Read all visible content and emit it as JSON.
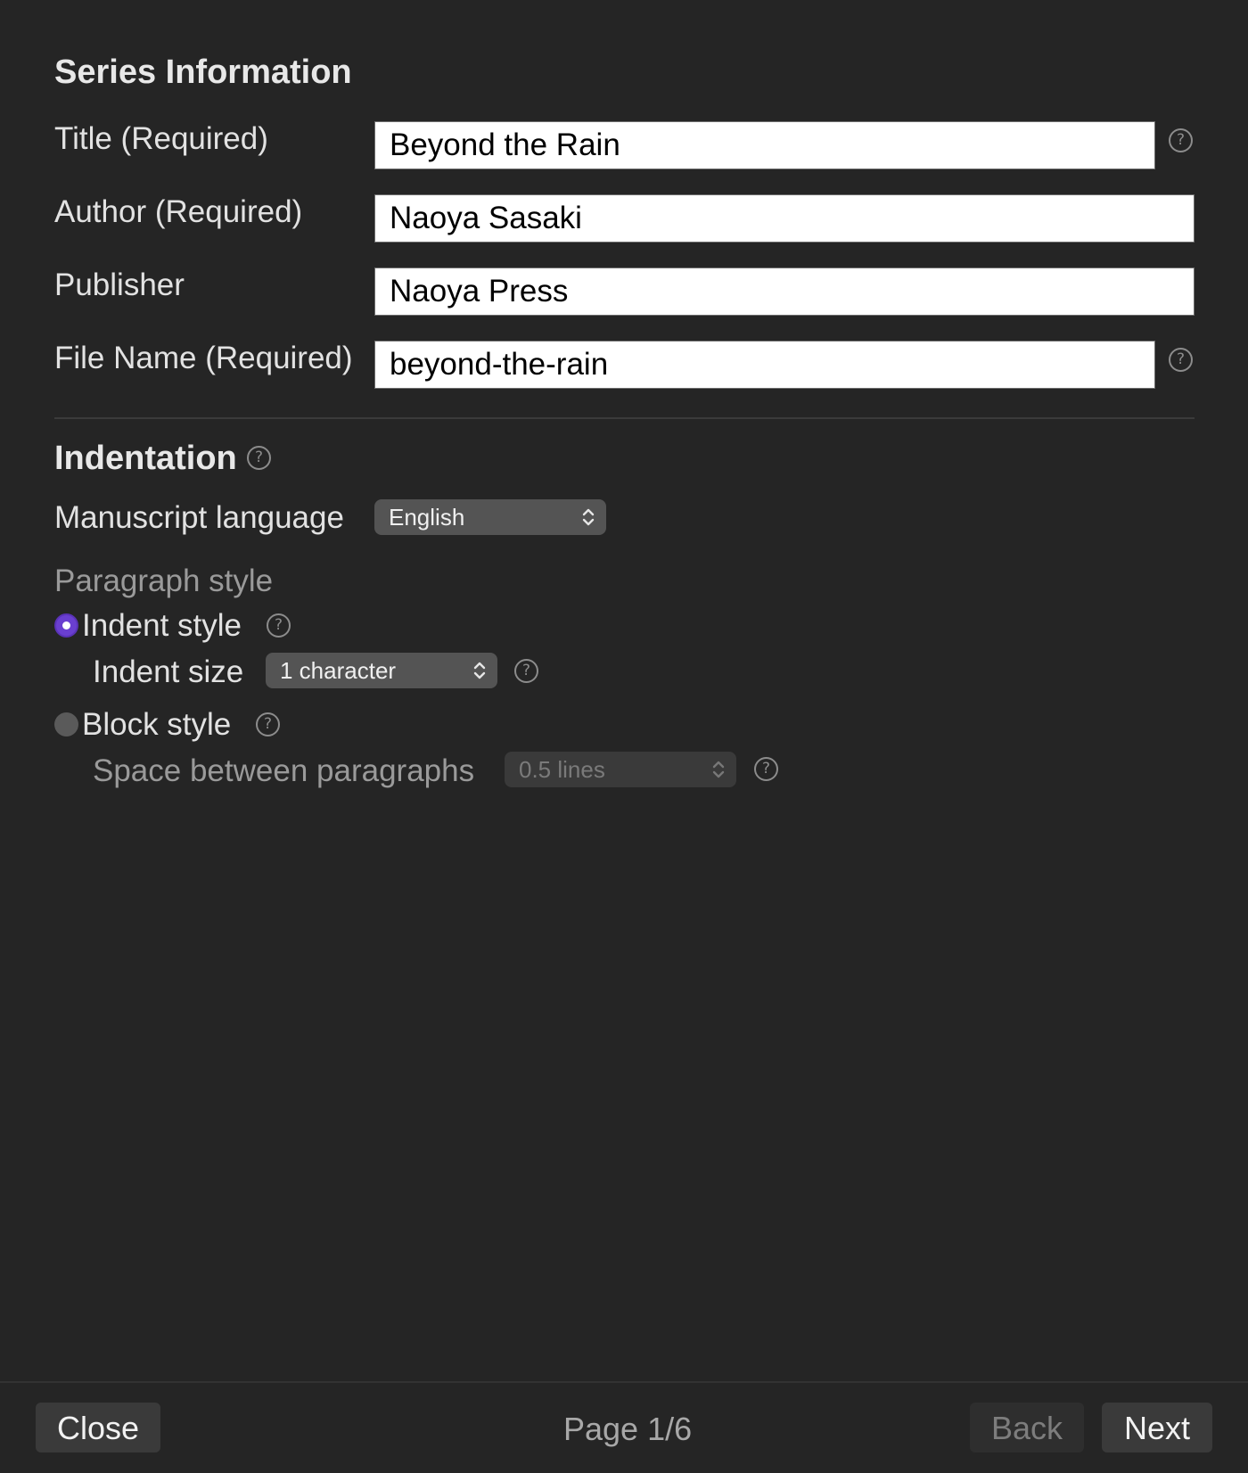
{
  "series_info": {
    "heading": "Series Information",
    "fields": [
      {
        "label": "Title (Required)",
        "value": "Beyond the Rain"
      },
      {
        "label": "Author (Required)",
        "value": "Naoya Sasaki"
      },
      {
        "label": "Publisher",
        "value": "Naoya Press"
      },
      {
        "label": "File Name (Required)",
        "value": "beyond-the-rain"
      }
    ]
  },
  "indentation": {
    "heading": "Indentation",
    "manuscript_language_label": "Manuscript language",
    "manuscript_language_value": "English",
    "paragraph_style_label": "Paragraph style",
    "indent_style_label": "Indent style",
    "indent_size_label": "Indent size",
    "indent_size_value": "1 character",
    "block_style_label": "Block style",
    "space_between_label": "Space between paragraphs",
    "space_between_value": "0.5 lines",
    "selected_style": "indent"
  },
  "footer": {
    "close_label": "Close",
    "page_indicator": "Page 1/6",
    "back_label": "Back",
    "next_label": "Next"
  },
  "icons": {
    "help": "?"
  },
  "colors": {
    "background": "#252525",
    "accent": "#6a3fd0"
  }
}
